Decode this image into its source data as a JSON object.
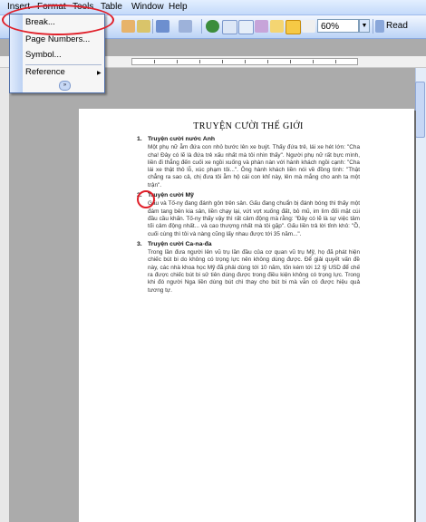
{
  "menubar": {
    "items": [
      {
        "label": "Insert"
      },
      {
        "label": "Format"
      },
      {
        "label": "Tools"
      },
      {
        "label": "Table"
      },
      {
        "label": "Window"
      },
      {
        "label": "Help"
      }
    ]
  },
  "toolbar": {
    "zoom_value": "60%",
    "read_label": "Read"
  },
  "insert_menu": {
    "items": [
      {
        "label": "Break..."
      },
      {
        "label": "Page Numbers..."
      },
      {
        "label": "Symbol..."
      },
      {
        "label": "Reference"
      }
    ],
    "more_glyph": "»"
  },
  "document": {
    "title": "TRUYỆN CƯỜI THẾ GIỚI",
    "items": [
      {
        "number": "1.",
        "heading": "Truyện cười nước Anh",
        "body": "Một phụ nữ ẵm đứa con nhỏ bước lên xe buýt. Thấy đứa trẻ, lái xe hét lớn: \"Cha cha! Đây có lẽ là đứa trẻ xấu nhất mà tôi nhìn thấy\". Người phụ nữ rất bực mình, liền đi thẳng đến cuối xe ngồi xuống và phàn nàn với hành khách ngồi cạnh: \"Cha lái xe thật thô lỗ, xúc phạm tôi...\". Ông hành khách liền nói về đồng tình: \"Thật chẳng ra sao cả, chị đưa tôi ẵm hộ cái con khỉ này, lên mà mắng cho anh ta một trận\"."
      },
      {
        "number": "2.",
        "heading": "Truyện cười Mỹ",
        "body": "Gấu và Tố-ny đang đánh gôn trên sân. Gấu đang chuẩn bị đánh bóng thì thấy một đám tang bên kia sân, liền chạy lại, vứt vợt xuống đất, bỏ mũ, im lìm đối mặt cúi đầu cầu khấn. Tố-ny thấy vậy thì rất cảm động mà rằng: \"Đây có lẽ là sự việc tâm tối cảm động nhất... và cao thượng nhất mà tôi gặp\". Gấu liền trả lời tỉnh khô: \"Ồ, cuối cùng thì tôi và nàng cũng lấy nhau được tới 35 năm...\"."
      },
      {
        "number": "3.",
        "heading": "Truyện cười Ca-na-đa",
        "body": "Trong lần đưa người lên vũ trụ lần đầu của cơ quan vũ trụ Mỹ, họ đã phát hiện chiếc bút bi do không có trọng lực nên không dùng được. Để giải quyết vấn đề này, các nhà khoa học Mỹ đã phải dùng tới 10 năm, tốn kém tới 12 tỷ USD để chế ra được chiếc bút bi sử tiên dùng được trong điều kiện không có trọng lực. Trong khi đó người Nga liền dùng bút chì thay cho bút bi mà vẫn có được hiệu quả tương tự."
      }
    ]
  },
  "colors": {
    "annotation": "#E0202A",
    "menu_border": "#4E6EA8"
  }
}
